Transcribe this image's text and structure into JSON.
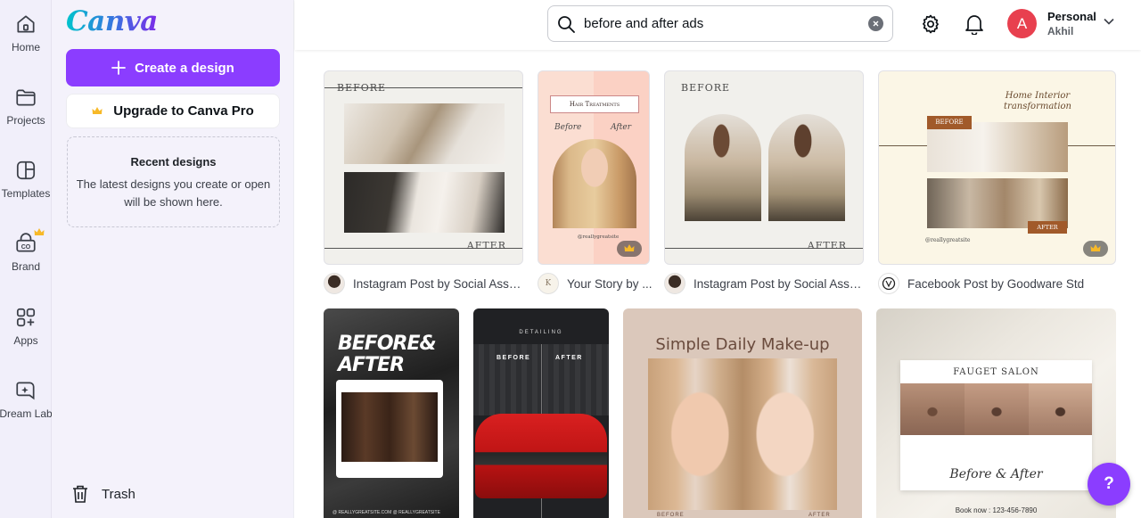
{
  "rail": {
    "items": [
      {
        "label": "Home",
        "icon": "home-icon"
      },
      {
        "label": "Projects",
        "icon": "folder-icon"
      },
      {
        "label": "Templates",
        "icon": "templates-icon"
      },
      {
        "label": "Brand",
        "icon": "brand-icon"
      },
      {
        "label": "Apps",
        "icon": "apps-icon"
      },
      {
        "label": "Dream Lab",
        "icon": "dream-lab-icon"
      }
    ]
  },
  "panel": {
    "logo": "Canva",
    "create_label": "Create a design",
    "upgrade_label": "Upgrade to Canva Pro",
    "recent_title": "Recent designs",
    "recent_desc": "The latest designs you create or open will be shown here.",
    "trash_label": "Trash"
  },
  "topbar": {
    "search_value": "before and after ads",
    "account_name": "Personal",
    "account_user": "Akhil",
    "avatar_initial": "A"
  },
  "results": [
    {
      "caption": "Instagram Post by Social Assu...",
      "texts": {
        "before": "BEFORE",
        "after": "AFTER"
      }
    },
    {
      "caption": "Your Story by ...",
      "avatar_letter": "K",
      "texts": {
        "title": "Hair Treatments",
        "before": "Before",
        "after": "After",
        "handle": "@reallygreatsite"
      }
    },
    {
      "caption": "Instagram Post by Social Assu...",
      "texts": {
        "before": "BEFORE",
        "after": "AFTER"
      }
    },
    {
      "caption": "Facebook Post by Goodware Std",
      "texts": {
        "title": "Home Interior transformation",
        "before": "BEFORE",
        "after": "AFTER",
        "handle": "@reallygreatsite"
      }
    },
    {
      "texts": {
        "title": "BEFORE& AFTER",
        "footer": "@ REALLYGREATSITE.COM   @ REALLYGREATSITE"
      }
    },
    {
      "texts": {
        "top": "DETAILING",
        "before": "BEFORE",
        "after": "AFTER"
      }
    },
    {
      "texts": {
        "title": "Simple Daily Make-up",
        "before": "BEFORE",
        "after": "AFTER"
      }
    },
    {
      "texts": {
        "title": "FAUGET SALON",
        "script": "Before & After",
        "phone": "Book now : 123-456-7890"
      }
    }
  ],
  "help_label": "?",
  "colors": {
    "accent": "#8b3dff",
    "avatar": "#e8404f",
    "rail_bg": "#f1effa"
  }
}
